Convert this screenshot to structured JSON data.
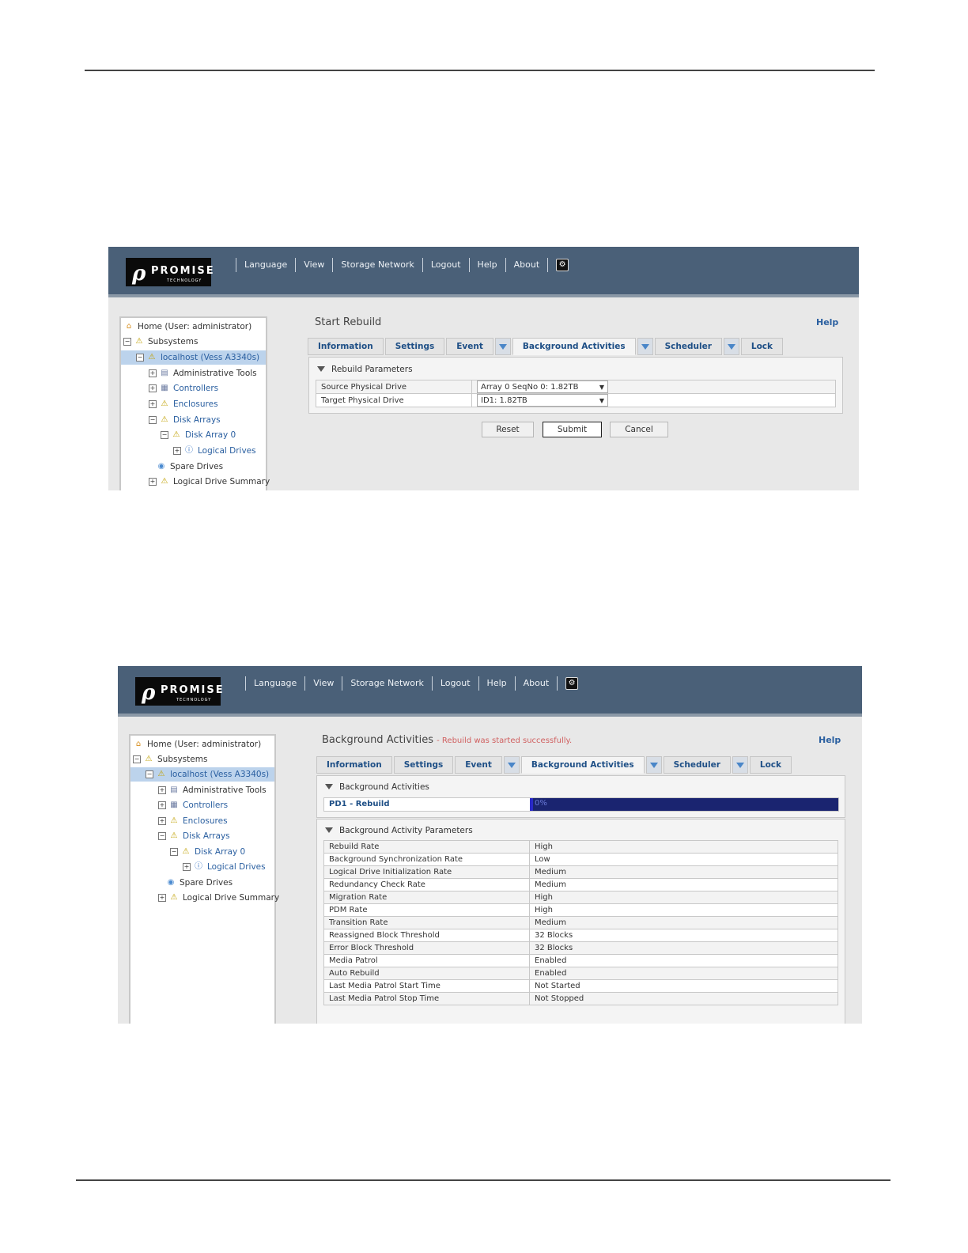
{
  "nav": [
    "Language",
    "View",
    "Storage Network",
    "Logout",
    "Help",
    "About"
  ],
  "logo": {
    "mark": "ρ",
    "brand": "PROMISE",
    "sub": "TECHNOLOGY"
  },
  "tree": {
    "home": "Home (User: administrator)",
    "subsystems": "Subsystems",
    "localhost": "localhost (Vess A3340s)",
    "admin_tools": "Administrative Tools",
    "controllers": "Controllers",
    "enclosures": "Enclosures",
    "disk_arrays": "Disk Arrays",
    "disk_array_0": "Disk Array 0",
    "logical_drives": "Logical Drives",
    "spare_drives": "Spare Drives",
    "ld_summary": "Logical Drive Summary"
  },
  "tabs": {
    "information": "Information",
    "settings": "Settings",
    "event": "Event",
    "background": "Background Activities",
    "scheduler": "Scheduler",
    "lock": "Lock"
  },
  "help": "Help",
  "shot1": {
    "title": "Start Rebuild",
    "section": "Rebuild Parameters",
    "rows": [
      {
        "label": "Source Physical Drive",
        "value": "Array 0 SeqNo 0: 1.82TB"
      },
      {
        "label": "Target Physical Drive",
        "value": "ID1: 1.82TB"
      }
    ],
    "buttons": {
      "reset": "Reset",
      "submit": "Submit",
      "cancel": "Cancel"
    }
  },
  "shot2": {
    "title": "Background Activities",
    "message": "- Rebuild was started successfully.",
    "section1": "Background Activities",
    "activity": {
      "name": "PD1 - Rebuild",
      "progress_text": "0%",
      "progress": 0.01
    },
    "section2": "Background Activity Parameters",
    "params": [
      {
        "label": "Rebuild Rate",
        "value": "High"
      },
      {
        "label": "Background Synchronization Rate",
        "value": "Low"
      },
      {
        "label": "Logical Drive Initialization Rate",
        "value": "Medium"
      },
      {
        "label": "Redundancy Check Rate",
        "value": "Medium"
      },
      {
        "label": "Migration Rate",
        "value": "High"
      },
      {
        "label": "PDM Rate",
        "value": "High"
      },
      {
        "label": "Transition Rate",
        "value": "Medium"
      },
      {
        "label": "Reassigned Block Threshold",
        "value": "32 Blocks"
      },
      {
        "label": "Error Block Threshold",
        "value": "32 Blocks"
      },
      {
        "label": "Media Patrol",
        "value": "Enabled"
      },
      {
        "label": "Auto Rebuild",
        "value": "Enabled"
      },
      {
        "label": "Last Media Patrol Start Time",
        "value": "Not Started"
      },
      {
        "label": "Last Media Patrol Stop Time",
        "value": "Not Stopped"
      }
    ]
  }
}
